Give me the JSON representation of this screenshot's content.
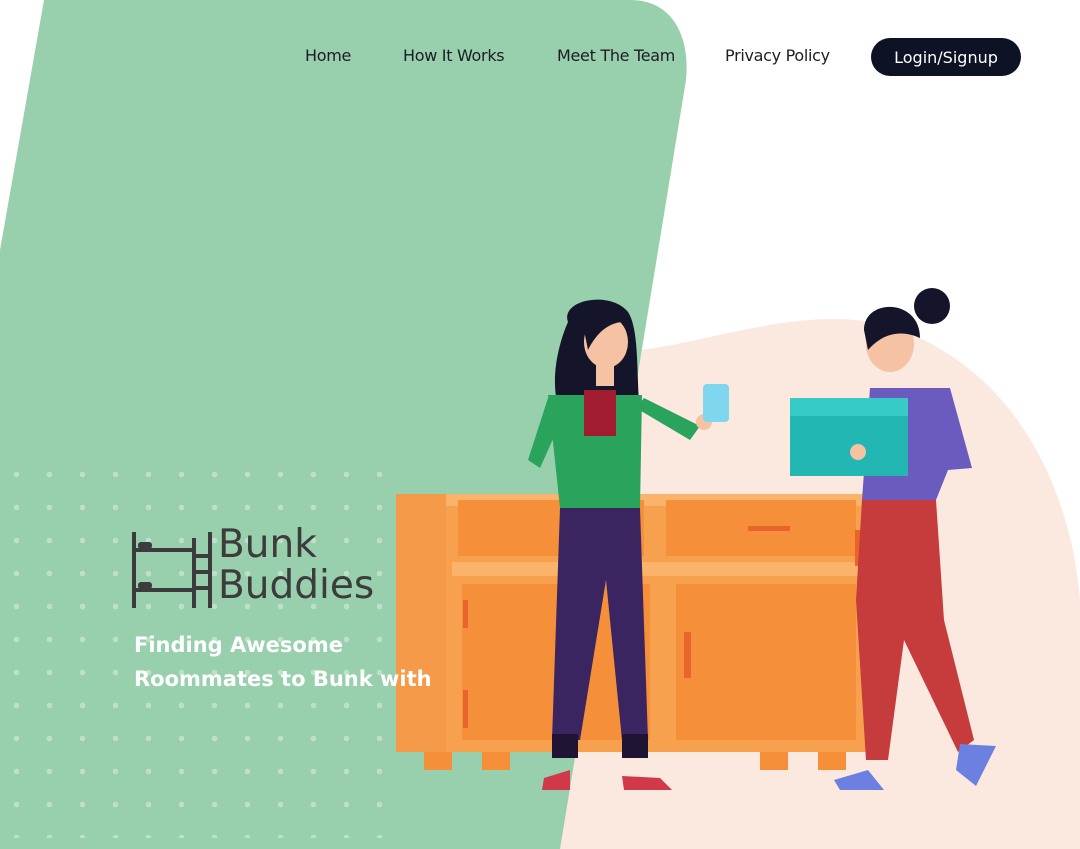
{
  "colors": {
    "background": "#ffffff",
    "green_panel": "#98cfac",
    "peach": "#fbe9df",
    "cabinet": "#f7a14f",
    "nav_text": "#1d1d24",
    "button_bg": "#0e1225",
    "brand_text": "#3c3c3c"
  },
  "nav": {
    "links": [
      {
        "label": "Home"
      },
      {
        "label": "How It Works"
      },
      {
        "label": "Meet The Team"
      },
      {
        "label": "Privacy Policy"
      }
    ],
    "login_label": "Login/Signup"
  },
  "brand": {
    "logo_icon": "bunk-bed-icon",
    "name_line1": "Bunk",
    "name_line2": "Buddies"
  },
  "hero": {
    "tagline_line1": "Finding Awesome",
    "tagline_line2": "Roommates to Bunk with"
  },
  "illustration": {
    "subject": "roommates-with-cabinet-illustration"
  }
}
